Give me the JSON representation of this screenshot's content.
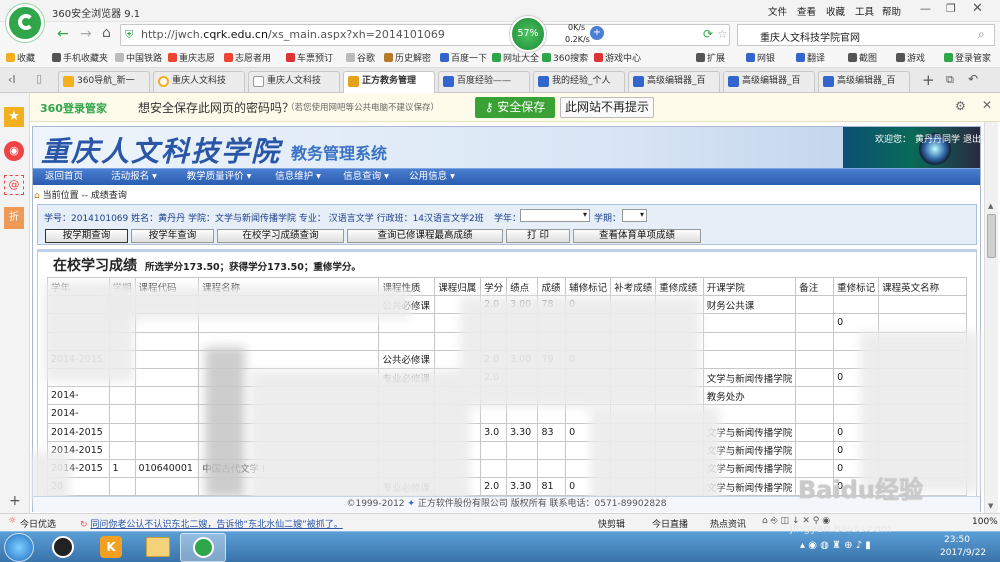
{
  "browser": {
    "title": "360安全浏览器 9.1",
    "menu": [
      "文件",
      "查看",
      "收藏",
      "工具",
      "帮助"
    ],
    "url_prefix": "http://jwch.",
    "url_domain": "cqrk.edu.cn",
    "url_path": "/xs_main.aspx?xh=2014101069",
    "speed_percent": "57%",
    "speed_up": "0K/s",
    "speed_down": "0.2K/s",
    "search_text": "重庆人文科技学院官网"
  },
  "favorites": {
    "items": [
      "收藏",
      "手机收藏夹",
      "中国铁路",
      "重庆志愿",
      "志愿者用",
      "车票预订",
      "谷歌",
      "历史解密",
      "百度一下",
      "网址大全",
      "360搜索",
      "游戏中心"
    ],
    "right": [
      "扩展",
      "网银",
      "翻译",
      "截图",
      "游戏",
      "登录管家"
    ]
  },
  "tabs": [
    "360导航_新一",
    "重庆人文科技",
    "重庆人文科技",
    "正方教务管理",
    "百度经验——",
    "我的经验_个人",
    "高级编辑器_百",
    "高级编辑器_百",
    "高级编辑器_百"
  ],
  "password_bar": {
    "brand": "360登录管家",
    "question": "想安全保存此网页的密码吗？",
    "note": "（若您使用网吧等公共电脑不建议保存）",
    "save_label": "安全保存",
    "never_label": "此网站不再提示"
  },
  "site": {
    "school_name": "重庆人文科技学院",
    "system_name": "教务管理系统",
    "welcome": "欢迎您：",
    "user_name": "黄丹丹同学",
    "logout": "退出",
    "nav": [
      "返回首页",
      "活动报名",
      "教学质量评价",
      "信息维护",
      "信息查询",
      "公用信息"
    ],
    "breadcrumb_label": "当前位置",
    "breadcrumb_page": "-- 成绩查询"
  },
  "student": {
    "line": "学号：2014101069  姓名：黄丹丹  学院：文学与新闻传播学院  专业：  汉语言文学  行政班：14汉语言文学2班",
    "year_label": "学年：",
    "term_label": "学期："
  },
  "buttons": [
    "按学期查询",
    "按学年查询",
    "在校学习成绩查询",
    "查询已修课程最高成绩",
    "打  印",
    "查看体育单项成绩"
  ],
  "grades": {
    "title": "在校学习成绩",
    "summary": "所选学分173.50；获得学分173.50；重修学分。",
    "headers": [
      "学年",
      "学期",
      "课程代码",
      "课程名称",
      "课程性质",
      "课程归属",
      "学分",
      "绩点",
      "成绩",
      "辅修标记",
      "补考成绩",
      "重修成绩",
      "开课学院",
      "备注",
      "重修标记",
      "课程英文名称"
    ],
    "rows": [
      [
        "",
        "",
        "",
        "",
        "公共必修课",
        "",
        "2.0",
        "3.00",
        "78",
        "0",
        "",
        "",
        "财务公共课",
        "",
        "",
        ""
      ],
      [
        "",
        "",
        "",
        "",
        "",
        "",
        "",
        "",
        "",
        "",
        "",
        "",
        "",
        "",
        "0",
        ""
      ],
      [
        "",
        "",
        "",
        "",
        "",
        "",
        "",
        "",
        "",
        "",
        "",
        "",
        "",
        "",
        "",
        ""
      ],
      [
        "2014-2015",
        "",
        "",
        "",
        "公共必修课",
        "",
        "2.0",
        "3.00",
        "79",
        "0",
        "",
        "",
        "",
        "",
        "",
        ""
      ],
      [
        "",
        "",
        "",
        "",
        "专业必修课",
        "",
        "2.0",
        "",
        "",
        "",
        "",
        "",
        "文学与新闻传播学院",
        "",
        "0",
        ""
      ],
      [
        "2014-",
        "",
        "",
        "",
        "",
        "",
        "",
        "",
        "",
        "",
        "",
        "",
        "教务处办",
        "",
        "",
        ""
      ],
      [
        "2014-",
        "",
        "",
        "",
        "",
        "",
        "",
        "",
        "",
        "",
        "",
        "",
        "",
        "",
        "",
        ""
      ],
      [
        "2014-2015",
        "",
        "",
        "",
        "",
        "",
        "3.0",
        "3.30",
        "83",
        "0",
        "",
        "",
        "文学与新闻传播学院",
        "",
        "0",
        ""
      ],
      [
        "2014-2015",
        "",
        "",
        "",
        "",
        "",
        "",
        "",
        "",
        "",
        "",
        "",
        "文学与新闻传播学院",
        "",
        "0",
        ""
      ],
      [
        "2014-2015",
        "1",
        "010640001",
        "中国古代文学 I",
        "",
        "",
        "",
        "",
        "",
        "",
        "",
        "",
        "文学与新闻传播学院",
        "",
        "0",
        ""
      ],
      [
        "20",
        "",
        "",
        "",
        "专业必修课",
        "",
        "2.0",
        "3.30",
        "81",
        "0",
        "",
        "",
        "文学与新闻传播学院",
        "",
        "0",
        ""
      ]
    ]
  },
  "footer": {
    "copyright": "©1999-2012",
    "company": "正方软件股份有限公司  版权所有  联系电话：0571-89902828"
  },
  "statusbar": {
    "left": "今日优选",
    "news": "同问你老公认不认识东北二嫂，告诉他“东北水仙二嫂”被抓了。",
    "items": [
      "快剪辑",
      "今日直播",
      "热点资讯"
    ],
    "zoom": "100%"
  },
  "taskbar": {
    "time": "23:50",
    "date": "2017/9/22"
  },
  "watermark": {
    "brand": "Baidu经验",
    "site": "jingyan.baidu.com"
  },
  "colors": {
    "site_blue": "#2f64b7",
    "header_bg": "#dde8f5",
    "save_green": "#3aa234",
    "browser_green": "#2fa64a"
  }
}
